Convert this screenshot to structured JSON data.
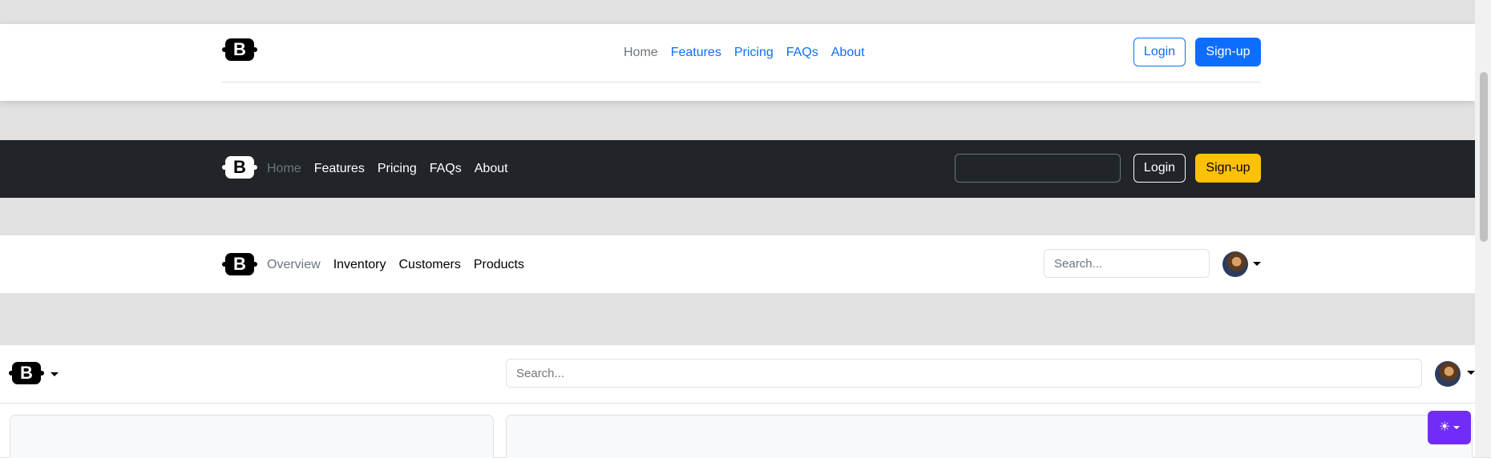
{
  "header1": {
    "logo_letter": "B",
    "nav": [
      "Home",
      "Features",
      "Pricing",
      "FAQs",
      "About"
    ],
    "login_label": "Login",
    "signup_label": "Sign-up"
  },
  "header2": {
    "logo_letter": "B",
    "nav": [
      "Home",
      "Features",
      "Pricing",
      "FAQs",
      "About"
    ],
    "search_value": "",
    "login_label": "Login",
    "signup_label": "Sign-up"
  },
  "header3": {
    "logo_letter": "B",
    "nav": [
      "Overview",
      "Inventory",
      "Customers",
      "Products"
    ],
    "search_placeholder": "Search..."
  },
  "header4": {
    "logo_letter": "B",
    "search_placeholder": "Search..."
  },
  "theme_toggle": {
    "icon": "sun-icon"
  },
  "colors": {
    "primary": "#0d6efd",
    "dark": "#212529",
    "warning": "#ffc107",
    "purple": "#712cf9"
  }
}
